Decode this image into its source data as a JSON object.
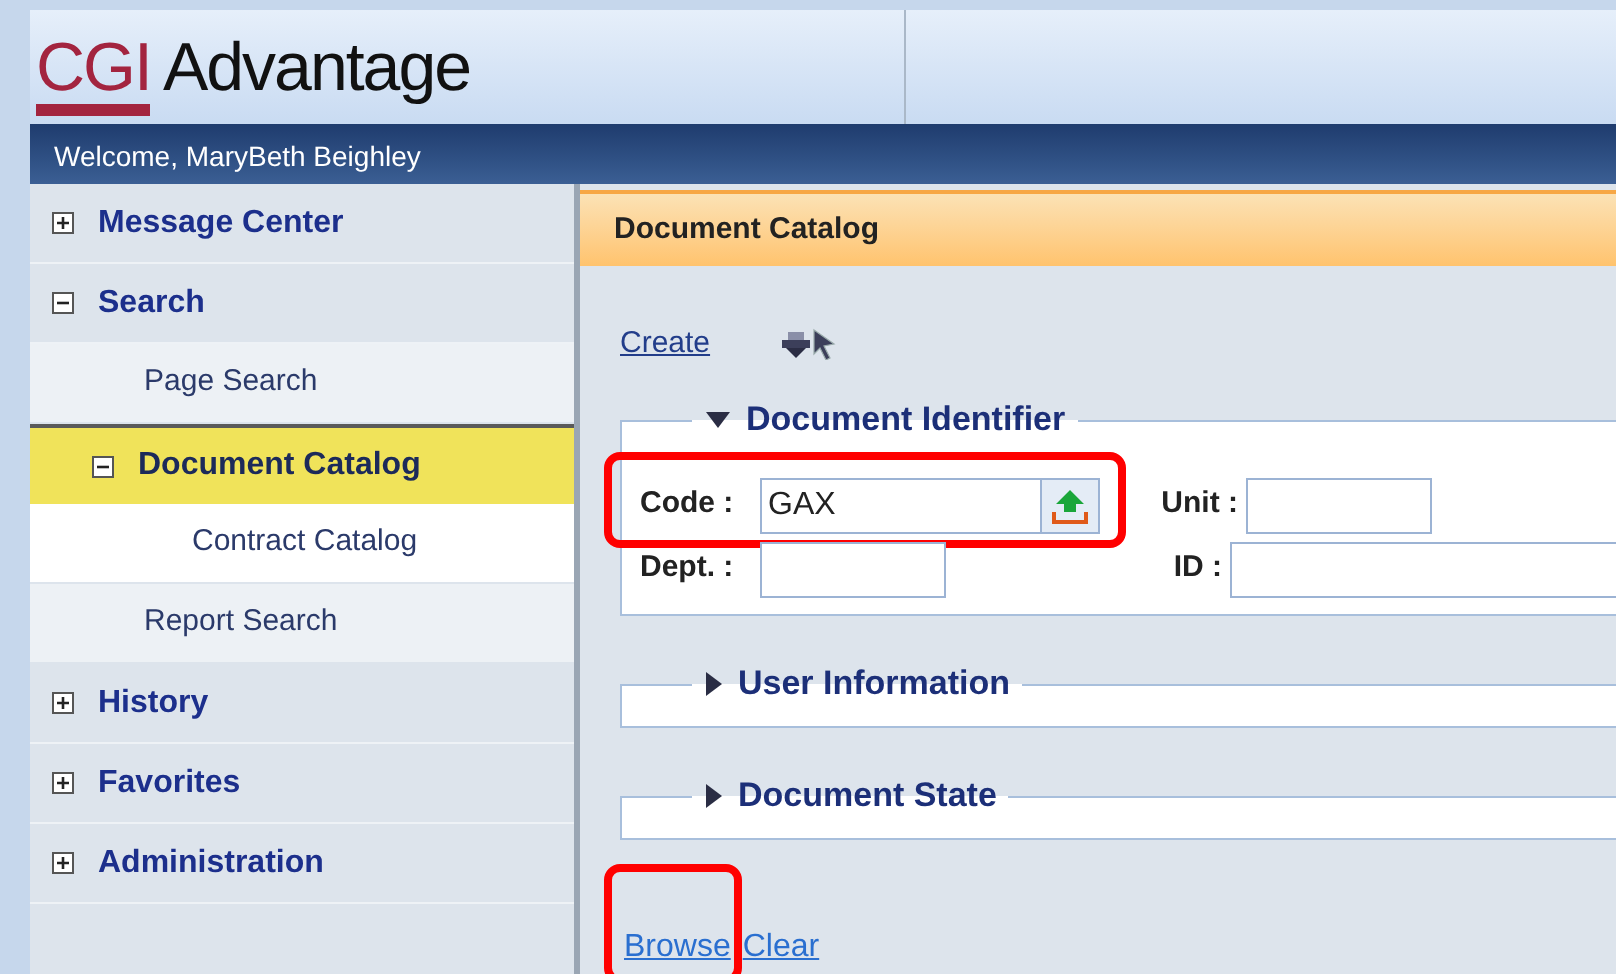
{
  "header": {
    "logo_mark": "CGI",
    "logo_text": "Advantage"
  },
  "welcome": "Welcome, MaryBeth Beighley",
  "sidebar": {
    "items": [
      {
        "label": "Message Center",
        "expanded": false,
        "selected": false
      },
      {
        "label": "Search",
        "expanded": true,
        "selected": false,
        "children": [
          {
            "label": "Page Search",
            "selected": false
          },
          {
            "label": "Document Catalog",
            "expanded": true,
            "selected": true,
            "children": [
              {
                "label": "Contract Catalog",
                "selected": false
              }
            ]
          },
          {
            "label": "Report Search",
            "selected": false
          }
        ]
      },
      {
        "label": "History",
        "expanded": false,
        "selected": false
      },
      {
        "label": "Favorites",
        "expanded": false,
        "selected": false
      },
      {
        "label": "Administration",
        "expanded": false,
        "selected": false
      }
    ]
  },
  "page_title": "Document Catalog",
  "toolbar": {
    "create_link": "Create"
  },
  "sections": [
    {
      "title": "Document Identifier",
      "expanded": true,
      "fields": [
        {
          "label": "Code :",
          "value": "GAX",
          "lookup": true,
          "highlighted": true
        },
        {
          "label": "Unit :",
          "lookup": false,
          "highlighted": false
        },
        {
          "label": "Dept. :",
          "lookup": false,
          "highlighted": false
        },
        {
          "label": "ID :",
          "lookup": false,
          "highlighted": false
        }
      ]
    },
    {
      "title": "User Information",
      "expanded": false
    },
    {
      "title": "Document State",
      "expanded": false
    }
  ],
  "actions": [
    {
      "label": "Browse",
      "highlighted": true
    },
    {
      "label": "Clear",
      "highlighted": false
    }
  ]
}
